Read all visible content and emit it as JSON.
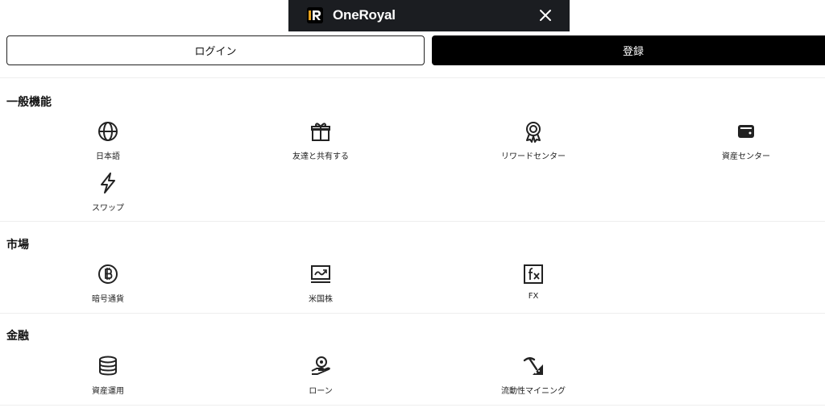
{
  "banner": {
    "app_name": "OneRoyal",
    "logo_icon": "oneroyal-logo-icon",
    "close_icon": "close-icon",
    "background": "#1b1d21"
  },
  "auth": {
    "login_label": "ログイン",
    "register_label": "登録"
  },
  "sections": [
    {
      "title": "一般機能",
      "items": [
        {
          "label": "日本語",
          "icon": "globe-icon"
        },
        {
          "label": "友達と共有する",
          "icon": "gift-icon"
        },
        {
          "label": "リワードセンター",
          "icon": "award-icon"
        },
        {
          "label": "資産センター",
          "icon": "wallet-icon"
        },
        {
          "label": "スワップ",
          "icon": "lightning-icon"
        }
      ]
    },
    {
      "title": "市場",
      "items": [
        {
          "label": "暗号通貨",
          "icon": "bitcoin-icon"
        },
        {
          "label": "米国株",
          "icon": "stock-chart-icon"
        },
        {
          "label": "FX",
          "icon": "fx-icon"
        }
      ]
    },
    {
      "title": "金融",
      "items": [
        {
          "label": "資産運用",
          "icon": "coin-stack-icon"
        },
        {
          "label": "ローン",
          "icon": "loan-hand-icon"
        },
        {
          "label": "流動性マイニング",
          "icon": "mining-pickaxe-icon"
        }
      ]
    }
  ]
}
